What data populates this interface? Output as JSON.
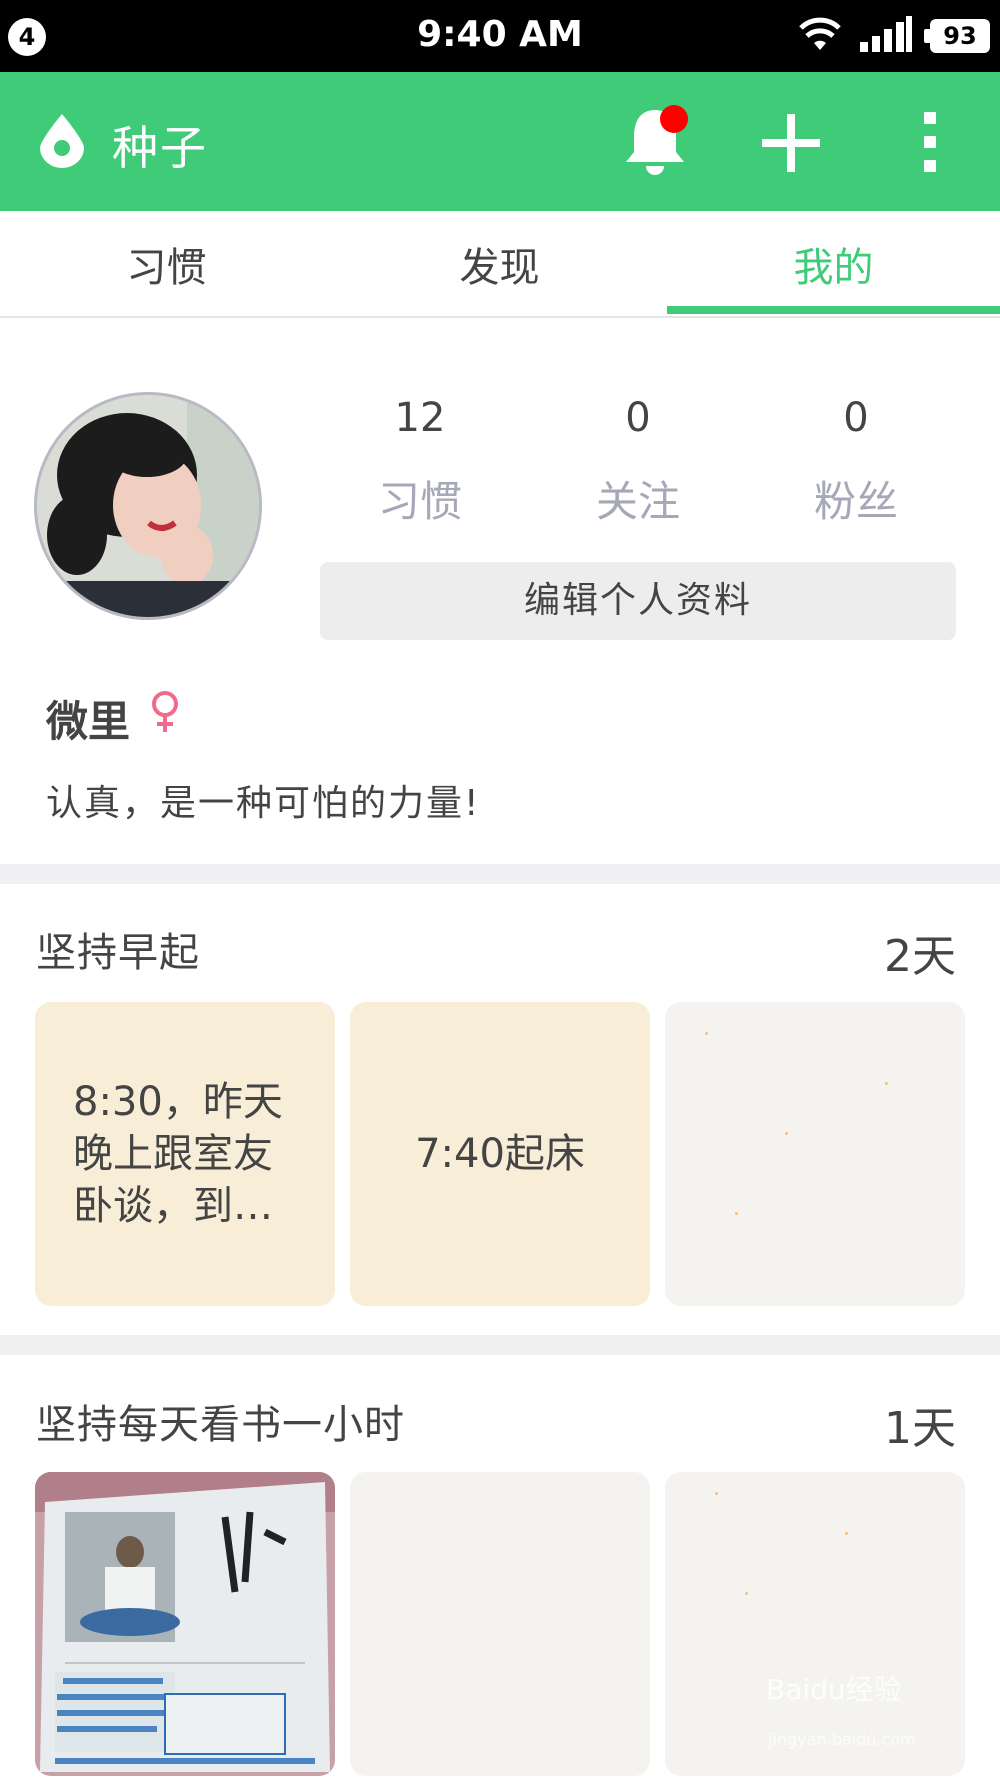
{
  "status_bar": {
    "notification_count": "4",
    "time": "9:40 AM",
    "battery": "93"
  },
  "app_bar": {
    "title": "种子"
  },
  "tabs": [
    {
      "label": "习惯",
      "active": false
    },
    {
      "label": "发现",
      "active": false
    },
    {
      "label": "我的",
      "active": true
    }
  ],
  "profile": {
    "stats": [
      {
        "value": "12",
        "label": "习惯"
      },
      {
        "value": "0",
        "label": "关注"
      },
      {
        "value": "0",
        "label": "粉丝"
      }
    ],
    "edit_label": "编辑个人资料",
    "username": "微里",
    "gender_symbol": "♀",
    "bio": "认真，是一种可怕的力量!"
  },
  "habits": [
    {
      "title": "坚持早起",
      "days": "2天",
      "cards": [
        "8:30，昨天晚上跟室友卧谈，到…",
        "7:40起床",
        ""
      ]
    },
    {
      "title": "坚持每天看书一小时",
      "days": "1天",
      "cards": [
        "",
        "",
        ""
      ]
    }
  ],
  "watermark": {
    "text": "Baidu经验",
    "sub": "jingyan.baidu.com"
  },
  "colors": {
    "brand_green": "#3fcb78",
    "badge_red": "#ff0000",
    "muted_label": "#a6a8b8"
  }
}
